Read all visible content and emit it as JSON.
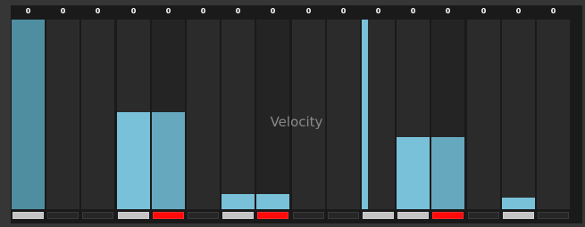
{
  "editor": {
    "label": "Velocity"
  },
  "colors": {
    "bar_light": "#78c1d8",
    "bar_dark": "#66a9be",
    "bar_steel": "#4f8ea1",
    "toggle_on": "#c4c4c4",
    "toggle_accent": "#ff0a0a"
  },
  "steps": [
    {
      "count": "0",
      "velocity": 1.0,
      "tone": "steel",
      "toggle": "on"
    },
    {
      "count": "0",
      "velocity": 0,
      "tone": "light",
      "toggle": "off"
    },
    {
      "count": "0",
      "velocity": 0,
      "tone": "light",
      "toggle": "off"
    },
    {
      "count": "0",
      "velocity": 0.51,
      "tone": "light",
      "toggle": "on"
    },
    {
      "count": "0",
      "velocity": 0.51,
      "tone": "dark",
      "toggle": "red"
    },
    {
      "count": "0",
      "velocity": 0,
      "tone": "light",
      "toggle": "off"
    },
    {
      "count": "0",
      "velocity": 0.08,
      "tone": "light",
      "toggle": "on"
    },
    {
      "count": "0",
      "velocity": 0.08,
      "tone": "light",
      "toggle": "red"
    },
    {
      "count": "0",
      "velocity": 0,
      "tone": "light",
      "toggle": "off"
    },
    {
      "count": "0",
      "velocity": 0,
      "tone": "light",
      "toggle": "off"
    },
    {
      "count": "0",
      "velocity": 1.0,
      "tone": "thin",
      "toggle": "on"
    },
    {
      "count": "0",
      "velocity": 0.38,
      "tone": "light",
      "toggle": "on"
    },
    {
      "count": "0",
      "velocity": 0.38,
      "tone": "dark",
      "toggle": "red"
    },
    {
      "count": "0",
      "velocity": 0,
      "tone": "light",
      "toggle": "off"
    },
    {
      "count": "0",
      "velocity": 0.06,
      "tone": "light",
      "toggle": "on"
    },
    {
      "count": "0",
      "velocity": 0,
      "tone": "light",
      "toggle": "off"
    }
  ]
}
